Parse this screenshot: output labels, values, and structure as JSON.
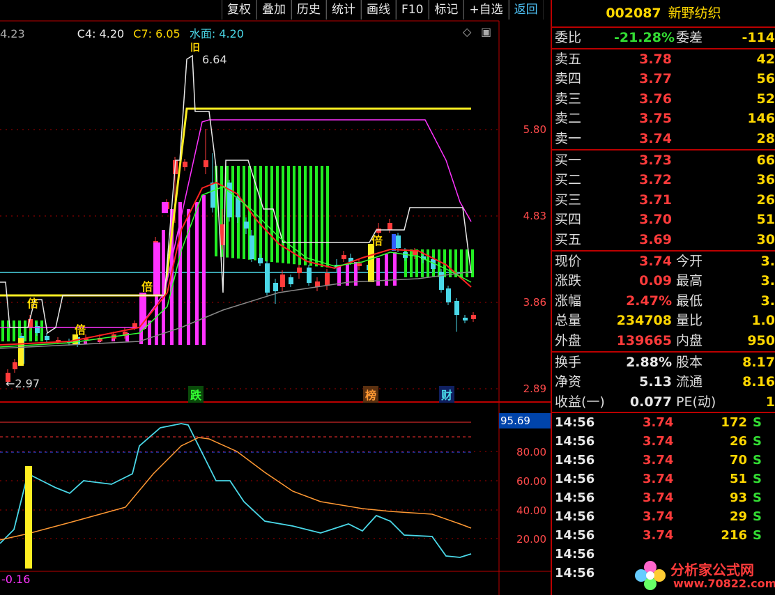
{
  "toolbar": {
    "buttons": [
      "复权",
      "叠加",
      "历史",
      "统计",
      "画线",
      "F10",
      "标记",
      "+自选",
      "返回"
    ]
  },
  "indicator": {
    "left_value": "4.23",
    "c4": "C4: 4.20",
    "c7": "C7: 6.05",
    "water": "水面: 4.20"
  },
  "main_axis": [
    "5.80",
    "4.83",
    "3.86",
    "2.89"
  ],
  "annotations": {
    "high": "6.64",
    "low": "2.97",
    "tag_high": "旧",
    "tag_bei1": "倍",
    "tag_bei2": "倍",
    "tag_bei3": "倍",
    "tag_bei4": "倍",
    "tag_die": "跌",
    "tag_bang": "榜",
    "tag_cai": "财"
  },
  "sub_axis": {
    "current": "95.69",
    "labels": [
      "80.00",
      "60.00",
      "40.00",
      "20.00"
    ],
    "bottom_value": "-0.16"
  },
  "stock": {
    "code": "002087",
    "name": "新野纺织"
  },
  "order_ratio": {
    "label": "委比",
    "value": "-21.28%",
    "label2": "委差",
    "value2": "-114"
  },
  "asks": [
    {
      "label": "卖五",
      "price": "3.78",
      "vol": "42"
    },
    {
      "label": "卖四",
      "price": "3.77",
      "vol": "56"
    },
    {
      "label": "卖三",
      "price": "3.76",
      "vol": "52"
    },
    {
      "label": "卖二",
      "price": "3.75",
      "vol": "146"
    },
    {
      "label": "卖一",
      "price": "3.74",
      "vol": "28"
    }
  ],
  "bids": [
    {
      "label": "买一",
      "price": "3.73",
      "vol": "66"
    },
    {
      "label": "买二",
      "price": "3.72",
      "vol": "36"
    },
    {
      "label": "买三",
      "price": "3.71",
      "vol": "26"
    },
    {
      "label": "买四",
      "price": "3.70",
      "vol": "51"
    },
    {
      "label": "买五",
      "price": "3.69",
      "vol": "30"
    }
  ],
  "stats1": [
    {
      "l1": "现价",
      "v1": "3.74",
      "c1": "red",
      "l2": "今开",
      "v2": "3."
    },
    {
      "l1": "涨跌",
      "v1": "0.09",
      "c1": "red",
      "l2": "最高",
      "v2": "3."
    },
    {
      "l1": "涨幅",
      "v1": "2.47%",
      "c1": "red",
      "l2": "最低",
      "v2": "3."
    },
    {
      "l1": "总量",
      "v1": "234708",
      "c1": "yellow",
      "l2": "量比",
      "v2": "1.0"
    },
    {
      "l1": "外盘",
      "v1": "139665",
      "c1": "red",
      "l2": "内盘",
      "v2": "950"
    }
  ],
  "stats2": [
    {
      "l1": "换手",
      "v1": "2.88%",
      "l2": "股本",
      "v2": "8.17"
    },
    {
      "l1": "净资",
      "v1": "5.13",
      "l2": "流通",
      "v2": "8.16"
    },
    {
      "l1": "收益(一)",
      "v1": "0.077",
      "l2": "PE(动)",
      "v2": "1"
    }
  ],
  "ticks": [
    {
      "time": "14:56",
      "price": "3.74",
      "vol": "172",
      "side": "S"
    },
    {
      "time": "14:56",
      "price": "3.74",
      "vol": "26",
      "side": "S"
    },
    {
      "time": "14:56",
      "price": "3.74",
      "vol": "70",
      "side": "S"
    },
    {
      "time": "14:56",
      "price": "3.74",
      "vol": "51",
      "side": "S"
    },
    {
      "time": "14:56",
      "price": "3.74",
      "vol": "93",
      "side": "S"
    },
    {
      "time": "14:56",
      "price": "3.74",
      "vol": "29",
      "side": "S"
    },
    {
      "time": "14:56",
      "price": "3.74",
      "vol": "216",
      "side": "S"
    },
    {
      "time": "14:56",
      "price": "",
      "vol": "",
      "side": ""
    },
    {
      "time": "14:56",
      "price": "",
      "vol": "",
      "side": ""
    }
  ],
  "watermark": {
    "text": "分析家公式网",
    "url": "www.70822.com"
  },
  "colors": {
    "up": "#ff3b3b",
    "down": "#4ad8e8",
    "accent": "#ffd700",
    "magenta": "#ff33ff",
    "green": "#33ff33"
  }
}
